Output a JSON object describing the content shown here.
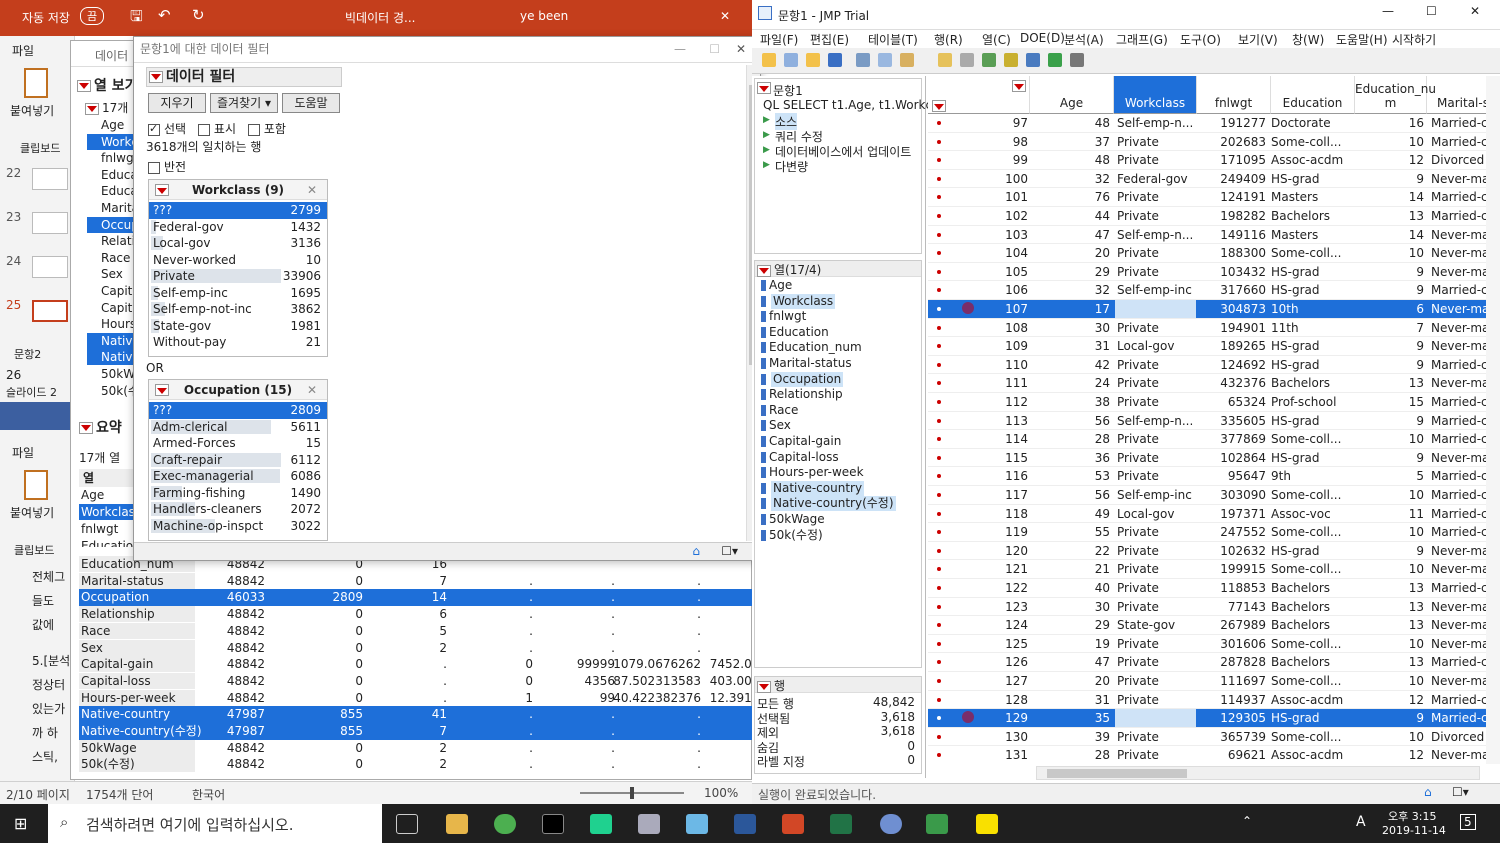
{
  "ppt": {
    "autosave": "자동 저장",
    "autosave_state": "끔",
    "title": "빅데이터 경...",
    "user": "ye been",
    "menu_file": "파일",
    "paste": "붙여넣기",
    "clipboard": "클립보드",
    "slide_nums": [
      "22",
      "23",
      "24",
      "25"
    ],
    "group_label": "문항2",
    "slide_26": "26",
    "slide_label": "슬라이드 2",
    "lower_file": "파일",
    "lower_paste": "붙여넣기",
    "lower_clip": "클립보드",
    "side_texts": [
      "전체그",
      "들도",
      "값에",
      "5.[분석",
      "정상터",
      "있는가",
      "까 하",
      "스틱,"
    ],
    "status_page": "2/10 페이지",
    "status_words": "1754개 단어",
    "status_lang": "한국어",
    "zoom": "100%"
  },
  "dt": {
    "title": "데이터",
    "col_view": "열 보기",
    "col_count": "17개",
    "summary_title": "요약",
    "summary_cols": "17개 열",
    "summary_header": "열",
    "cols": [
      "Age",
      "Workclass",
      "fnlwgt",
      "Education",
      "Education_num",
      "Marital-status",
      "Occupation",
      "Relationship",
      "Race",
      "Sex",
      "Capital-gain",
      "Capital-loss",
      "Hours-per-week",
      "Native-country",
      "Native-country(수정)",
      "50kWage",
      "50k(수정)"
    ]
  },
  "summary_rows": [
    {
      "name": "Education_num",
      "n": "48842",
      "miss": "0",
      "cat": "16",
      "a": "",
      "b": "",
      "c": "",
      "d": "",
      "e": ""
    },
    {
      "name": "Marital-status",
      "n": "48842",
      "miss": "0",
      "cat": "7",
      "a": ".",
      "b": ".",
      "c": ".",
      "d": "",
      "e": ""
    },
    {
      "name": "Occupation",
      "n": "46033",
      "miss": "2809",
      "cat": "14",
      "a": ".",
      "b": ".",
      "c": ".",
      "d": "",
      "e": ""
    },
    {
      "name": "Relationship",
      "n": "48842",
      "miss": "0",
      "cat": "6",
      "a": ".",
      "b": ".",
      "c": ".",
      "d": "",
      "e": ""
    },
    {
      "name": "Race",
      "n": "48842",
      "miss": "0",
      "cat": "5",
      "a": ".",
      "b": ".",
      "c": ".",
      "d": "",
      "e": ""
    },
    {
      "name": "Sex",
      "n": "48842",
      "miss": "0",
      "cat": "2",
      "a": ".",
      "b": ".",
      "c": ".",
      "d": "",
      "e": ""
    },
    {
      "name": "Capital-gain",
      "n": "48842",
      "miss": "0",
      "cat": ".",
      "a": "0",
      "b": "99999",
      "c": "1079.0676262",
      "d": "7452.019",
      "e": ""
    },
    {
      "name": "Capital-loss",
      "n": "48842",
      "miss": "0",
      "cat": ".",
      "a": "0",
      "b": "4356",
      "c": "87.502313583",
      "d": "403.0045",
      "e": ""
    },
    {
      "name": "Hours-per-week",
      "n": "48842",
      "miss": "0",
      "cat": ".",
      "a": "1",
      "b": "99",
      "c": "40.422382376",
      "d": "12.39144",
      "e": ""
    },
    {
      "name": "Native-country",
      "n": "47987",
      "miss": "855",
      "cat": "41",
      "a": ".",
      "b": ".",
      "c": ".",
      "d": "",
      "e": ""
    },
    {
      "name": "Native-country(수정)",
      "n": "47987",
      "miss": "855",
      "cat": "7",
      "a": ".",
      "b": ".",
      "c": ".",
      "d": "",
      "e": ""
    },
    {
      "name": "50kWage",
      "n": "48842",
      "miss": "0",
      "cat": "2",
      "a": ".",
      "b": ".",
      "c": ".",
      "d": "",
      "e": ""
    },
    {
      "name": "50k(수정)",
      "n": "48842",
      "miss": "0",
      "cat": "2",
      "a": ".",
      "b": ".",
      "c": ".",
      "d": "",
      "e": ""
    }
  ],
  "filter": {
    "window_title": "문항1에 대한 데이터 필터",
    "header": "데이터 필터",
    "btn_clear": "지우기",
    "btn_fav": "즐겨찾기",
    "btn_help": "도움말",
    "opt_select": "선택",
    "opt_show": "표시",
    "opt_include": "포함",
    "match_text": "3618개의 일치하는 행",
    "opt_invert": "반전",
    "or_text": "OR",
    "workclass_title": "Workclass (9)",
    "workclass": [
      {
        "label": "???",
        "count": "2799",
        "frac": 0.08
      },
      {
        "label": "Federal-gov",
        "count": "1432",
        "frac": 0.04
      },
      {
        "label": "Local-gov",
        "count": "3136",
        "frac": 0.09
      },
      {
        "label": "Never-worked",
        "count": "10",
        "frac": 0.0
      },
      {
        "label": "Private",
        "count": "33906",
        "frac": 1.0
      },
      {
        "label": "Self-emp-inc",
        "count": "1695",
        "frac": 0.05
      },
      {
        "label": "Self-emp-not-inc",
        "count": "3862",
        "frac": 0.11
      },
      {
        "label": "State-gov",
        "count": "1981",
        "frac": 0.06
      },
      {
        "label": "Without-pay",
        "count": "21",
        "frac": 0.0
      }
    ],
    "occupation_title": "Occupation (15)",
    "occupation": [
      {
        "label": "???",
        "count": "2809",
        "frac": 0.46
      },
      {
        "label": "Adm-clerical",
        "count": "5611",
        "frac": 0.92
      },
      {
        "label": "Armed-Forces",
        "count": "15",
        "frac": 0.0
      },
      {
        "label": "Craft-repair",
        "count": "6112",
        "frac": 1.0
      },
      {
        "label": "Exec-managerial",
        "count": "6086",
        "frac": 0.99
      },
      {
        "label": "Farming-fishing",
        "count": "1490",
        "frac": 0.24
      },
      {
        "label": "Handlers-cleaners",
        "count": "2072",
        "frac": 0.34
      },
      {
        "label": "Machine-op-inspct",
        "count": "3022",
        "frac": 0.49
      }
    ]
  },
  "jmp": {
    "title": "문항1 - JMP Trial",
    "menus": [
      "파일(F)",
      "편집(E)",
      "테이블(T)",
      "행(R)",
      "열(C)",
      "DOE(D)",
      "분석(A)",
      "그래프(G)",
      "도구(O)",
      "보기(V)",
      "창(W)",
      "도움말(H)",
      "시작하기"
    ],
    "tree_title": "문항1",
    "sql": "QL SELECT t1.Age, t1.Workcla",
    "sources": [
      "소스",
      "쿼리 수정",
      "데이터베이스에서 업데이트",
      "다변량"
    ],
    "cols_title": "열(17/4)",
    "cols": [
      "Age",
      "Workclass",
      "fnlwgt",
      "Education",
      "Education_num",
      "Marital-status",
      "Occupation",
      "Relationship",
      "Race",
      "Sex",
      "Capital-gain",
      "Capital-loss",
      "Hours-per-week",
      "Native-country",
      "Native-country(수정)",
      "50kWage",
      "50k(수정)"
    ],
    "rows_title": "행",
    "row_stats": [
      {
        "label": "모든 행",
        "value": "48,842"
      },
      {
        "label": "선택됨",
        "value": "3,618"
      },
      {
        "label": "제외",
        "value": "3,618"
      },
      {
        "label": "숨김",
        "value": "0"
      },
      {
        "label": "라벨 지정",
        "value": "0"
      }
    ],
    "status": "실행이 완료되었습니다.",
    "headers": [
      "Age",
      "Workclass",
      "fnlwgt",
      "Education",
      "Education_nu m",
      "Marital-s"
    ]
  },
  "grid": [
    [
      "97",
      "48",
      "Self-emp-n...",
      "191277",
      "Doctorate",
      "16",
      "Married-ci",
      0
    ],
    [
      "98",
      "37",
      "Private",
      "202683",
      "Some-coll...",
      "10",
      "Married-ci",
      0
    ],
    [
      "99",
      "48",
      "Private",
      "171095",
      "Assoc-acdm",
      "12",
      "Divorced",
      0
    ],
    [
      "100",
      "32",
      "Federal-gov",
      "249409",
      "HS-grad",
      "9",
      "Never-ma",
      0
    ],
    [
      "101",
      "76",
      "Private",
      "124191",
      "Masters",
      "14",
      "Married-ci",
      0
    ],
    [
      "102",
      "44",
      "Private",
      "198282",
      "Bachelors",
      "13",
      "Married-ci",
      0
    ],
    [
      "103",
      "47",
      "Self-emp-n...",
      "149116",
      "Masters",
      "14",
      "Never-ma",
      0
    ],
    [
      "104",
      "20",
      "Private",
      "188300",
      "Some-coll...",
      "10",
      "Never-ma",
      0
    ],
    [
      "105",
      "29",
      "Private",
      "103432",
      "HS-grad",
      "9",
      "Never-ma",
      0
    ],
    [
      "106",
      "32",
      "Self-emp-inc",
      "317660",
      "HS-grad",
      "9",
      "Married-ci",
      0
    ],
    [
      "107",
      "17",
      "",
      "304873",
      "10th",
      "6",
      "Never-ma",
      1
    ],
    [
      "108",
      "30",
      "Private",
      "194901",
      "11th",
      "7",
      "Never-ma",
      0
    ],
    [
      "109",
      "31",
      "Local-gov",
      "189265",
      "HS-grad",
      "9",
      "Never-ma",
      0
    ],
    [
      "110",
      "42",
      "Private",
      "124692",
      "HS-grad",
      "9",
      "Married-ci",
      0
    ],
    [
      "111",
      "24",
      "Private",
      "432376",
      "Bachelors",
      "13",
      "Never-ma",
      0
    ],
    [
      "112",
      "38",
      "Private",
      "65324",
      "Prof-school",
      "15",
      "Married-ci",
      0
    ],
    [
      "113",
      "56",
      "Self-emp-n...",
      "335605",
      "HS-grad",
      "9",
      "Married-ci",
      0
    ],
    [
      "114",
      "28",
      "Private",
      "377869",
      "Some-coll...",
      "10",
      "Married-ci",
      0
    ],
    [
      "115",
      "36",
      "Private",
      "102864",
      "HS-grad",
      "9",
      "Never-ma",
      0
    ],
    [
      "116",
      "53",
      "Private",
      "95647",
      "9th",
      "5",
      "Married-ci",
      0
    ],
    [
      "117",
      "56",
      "Self-emp-inc",
      "303090",
      "Some-coll...",
      "10",
      "Married-ci",
      0
    ],
    [
      "118",
      "49",
      "Local-gov",
      "197371",
      "Assoc-voc",
      "11",
      "Married-ci",
      0
    ],
    [
      "119",
      "55",
      "Private",
      "247552",
      "Some-coll...",
      "10",
      "Married-ci",
      0
    ],
    [
      "120",
      "22",
      "Private",
      "102632",
      "HS-grad",
      "9",
      "Never-ma",
      0
    ],
    [
      "121",
      "21",
      "Private",
      "199915",
      "Some-coll...",
      "10",
      "Never-ma",
      0
    ],
    [
      "122",
      "40",
      "Private",
      "118853",
      "Bachelors",
      "13",
      "Married-ci",
      0
    ],
    [
      "123",
      "30",
      "Private",
      "77143",
      "Bachelors",
      "13",
      "Never-ma",
      0
    ],
    [
      "124",
      "29",
      "State-gov",
      "267989",
      "Bachelors",
      "13",
      "Never-ma",
      0
    ],
    [
      "125",
      "19",
      "Private",
      "301606",
      "Some-coll...",
      "10",
      "Never-ma",
      0
    ],
    [
      "126",
      "47",
      "Private",
      "287828",
      "Bachelors",
      "13",
      "Married-ci",
      0
    ],
    [
      "127",
      "20",
      "Private",
      "111697",
      "Some-coll...",
      "10",
      "Never-ma",
      0
    ],
    [
      "128",
      "31",
      "Private",
      "114937",
      "Assoc-acdm",
      "12",
      "Married-ci",
      0
    ],
    [
      "129",
      "35",
      "",
      "129305",
      "HS-grad",
      "9",
      "Married-ci",
      1
    ],
    [
      "130",
      "39",
      "Private",
      "365739",
      "Some-coll...",
      "10",
      "Divorced",
      0
    ],
    [
      "131",
      "28",
      "Private",
      "69621",
      "Assoc-acdm",
      "12",
      "Never-ma",
      0
    ]
  ],
  "taskbar": {
    "search": "검색하려면 여기에 입력하십시오.",
    "time": "오후 3:15",
    "date": "2019-11-14",
    "ime": "A",
    "notif": "5"
  }
}
